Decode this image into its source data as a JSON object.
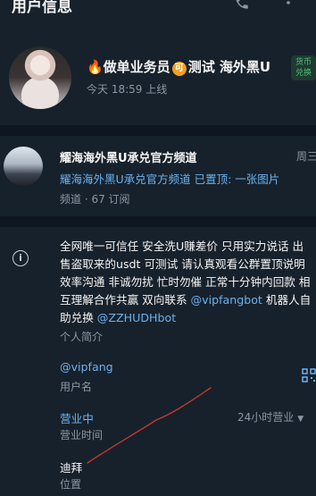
{
  "header": {
    "title": "用户信息",
    "icons": [
      "phone-icon",
      "more-options-icon"
    ]
  },
  "profile": {
    "name_prefix": "🔥做单业务员",
    "ke_badge": "可",
    "name_suffix": "测试 海外黑U",
    "exchange_badge": "货币\n兑换",
    "last_seen": "今天 18:59 上线"
  },
  "channel": {
    "name": "耀海海外黑U承兑官方频道",
    "day": "周三",
    "preview": "耀海海外黑U承兑官方频道 已置顶: 一张图片",
    "subtitle": "频道 · 67 订阅"
  },
  "info": {
    "bio_text": "全网唯一可信任 安全洗U赚差价 只用实力说话 出售盗取来的usdt 可测试 请认真观看公群置顶说明 效率沟通 非诚勿扰 忙时勿催 正常十分钟内回款 相互理解合作共赢 双向联系 ",
    "bio_link1": "@vipfangbot",
    "bio_mid": " 机器人自助兑换 ",
    "bio_link2": "@ZZHUDHbot",
    "bio_label": "个人简介",
    "username": "@vipfang",
    "username_label": "用户名",
    "status": "营业中",
    "hours": "24小时营业",
    "hours_label": "营业时间",
    "location": "迪拜",
    "location_label": "位置"
  },
  "colors": {
    "background": "#17212b",
    "divider": "#0e1621",
    "link": "#6ab2f2",
    "secondary_text": "#8b98a5",
    "annotation": "#c0392b"
  }
}
